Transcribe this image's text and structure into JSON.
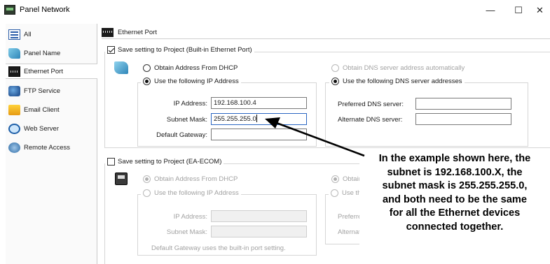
{
  "window": {
    "title": "Panel Network",
    "minimize": "—",
    "maximize": "☐",
    "close": "✕"
  },
  "sidebar": {
    "items": [
      {
        "label": "All",
        "icon": "list-icon"
      },
      {
        "label": "Panel Name",
        "icon": "book-icon"
      },
      {
        "label": "Ethernet Port",
        "icon": "ethernet-icon",
        "selected": true
      },
      {
        "label": "FTP Service",
        "icon": "ftp-icon"
      },
      {
        "label": "Email Client",
        "icon": "email-icon"
      },
      {
        "label": "Web Server",
        "icon": "http-icon"
      },
      {
        "label": "Remote Access",
        "icon": "remote-access-icon"
      }
    ]
  },
  "main": {
    "header": "Ethernet Port",
    "builtin": {
      "checkbox_label": "Save setting to Project (Built-in Ethernet Port)",
      "checked": true,
      "dhcp_label": "Obtain Address From DHCP",
      "static_label": "Use the following IP Address",
      "ip_label": "IP Address:",
      "ip_value": "192.168.100.4",
      "subnet_label": "Subnet Mask:",
      "subnet_value": "255.255.255.0",
      "gateway_label": "Default Gateway:",
      "gateway_value": "",
      "dns_auto_label": "Obtain DNS server address automatically",
      "dns_static_label": "Use the following DNS server addresses",
      "preferred_dns_label": "Preferred DNS server:",
      "preferred_dns_value": "",
      "alternate_dns_label": "Alternate DNS server:",
      "alternate_dns_value": ""
    },
    "ecom": {
      "checkbox_label": "Save setting to Project (EA-ECOM)",
      "checked": false,
      "dhcp_label": "Obtain Address From DHCP",
      "static_label": "Use the following IP Address",
      "ip_label": "IP Address:",
      "subnet_label": "Subnet Mask:",
      "gateway_note": "Default Gateway uses the built-in port setting.",
      "dns_auto_label_partial": "Obtain l",
      "dns_static_label_partial": "Use the",
      "preferred_partial": "Preferre",
      "alternate_partial": "Alternate"
    }
  },
  "callout": {
    "lines": [
      "In the example shown here, the",
      "subnet is 192.168.100.X, the",
      "subnet mask is 255.255.255.0,",
      "and both need to be the same",
      "for all the Ethernet devices",
      "connected together."
    ]
  }
}
